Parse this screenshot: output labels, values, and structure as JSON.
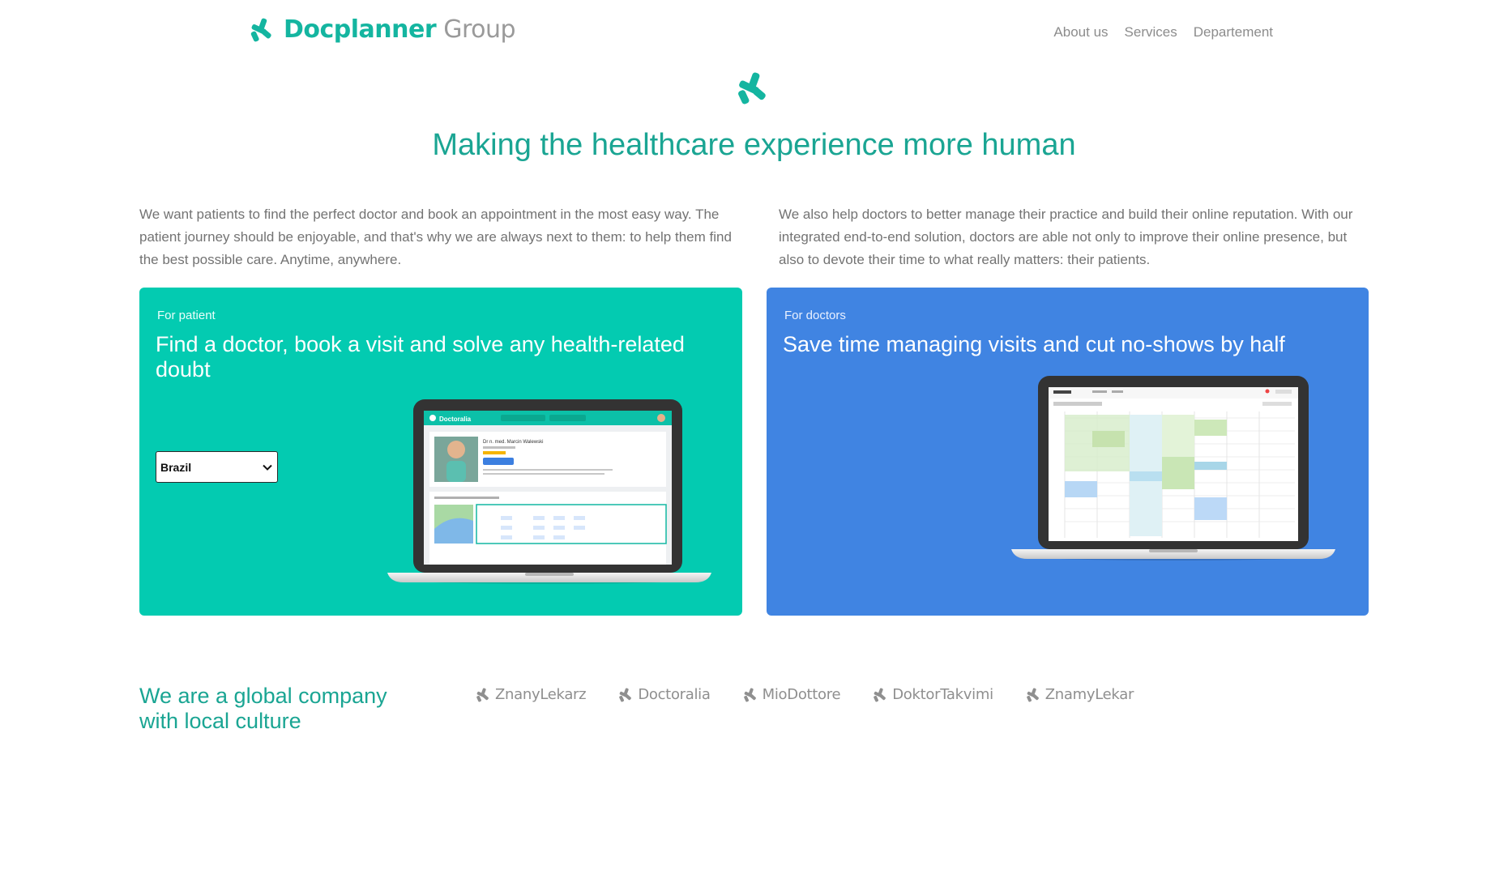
{
  "header": {
    "logo_brand": "Docplanner",
    "logo_group": "Group",
    "nav": [
      "About us",
      "Services",
      "Departement"
    ]
  },
  "hero": {
    "headline": "Making the healthcare experience more human"
  },
  "intro": {
    "left": "We want patients to find the perfect doctor and book an appointment in the most easy way. The patient journey should be enjoyable, and that's why we are always next to them: to help them find the best possible care. Anytime, anywhere.",
    "right": "We also help doctors to better manage their practice and build their online reputation. With our integrated end-to-end solution, doctors are able not only to improve their online presence, but also to devote their time to what really matters: their patients."
  },
  "cards": {
    "patient": {
      "eyebrow": "For patient",
      "title": "Find a doctor, book a visit and solve any health-related doubt",
      "country_selected": "Brazil",
      "bg": "#03cbb1"
    },
    "doctor": {
      "eyebrow": "For doctors",
      "title": "Save time managing visits and cut no-shows by half",
      "bg": "#4084e2"
    }
  },
  "screen_patient": {
    "app": "Doctoralia",
    "doctor_name": "Dr n. med. Marcin Walewski"
  },
  "global": {
    "title_line1": "We are a global company",
    "title_line2": "with local culture",
    "brands": [
      "ZnanyLekarz",
      "Doctoralia",
      "MioDottore",
      "DoktorTakvimi",
      "ZnamyLekar"
    ]
  },
  "colors": {
    "accent": "#1aa593",
    "patient_card": "#03cbb1",
    "doctor_card": "#4084e2"
  }
}
